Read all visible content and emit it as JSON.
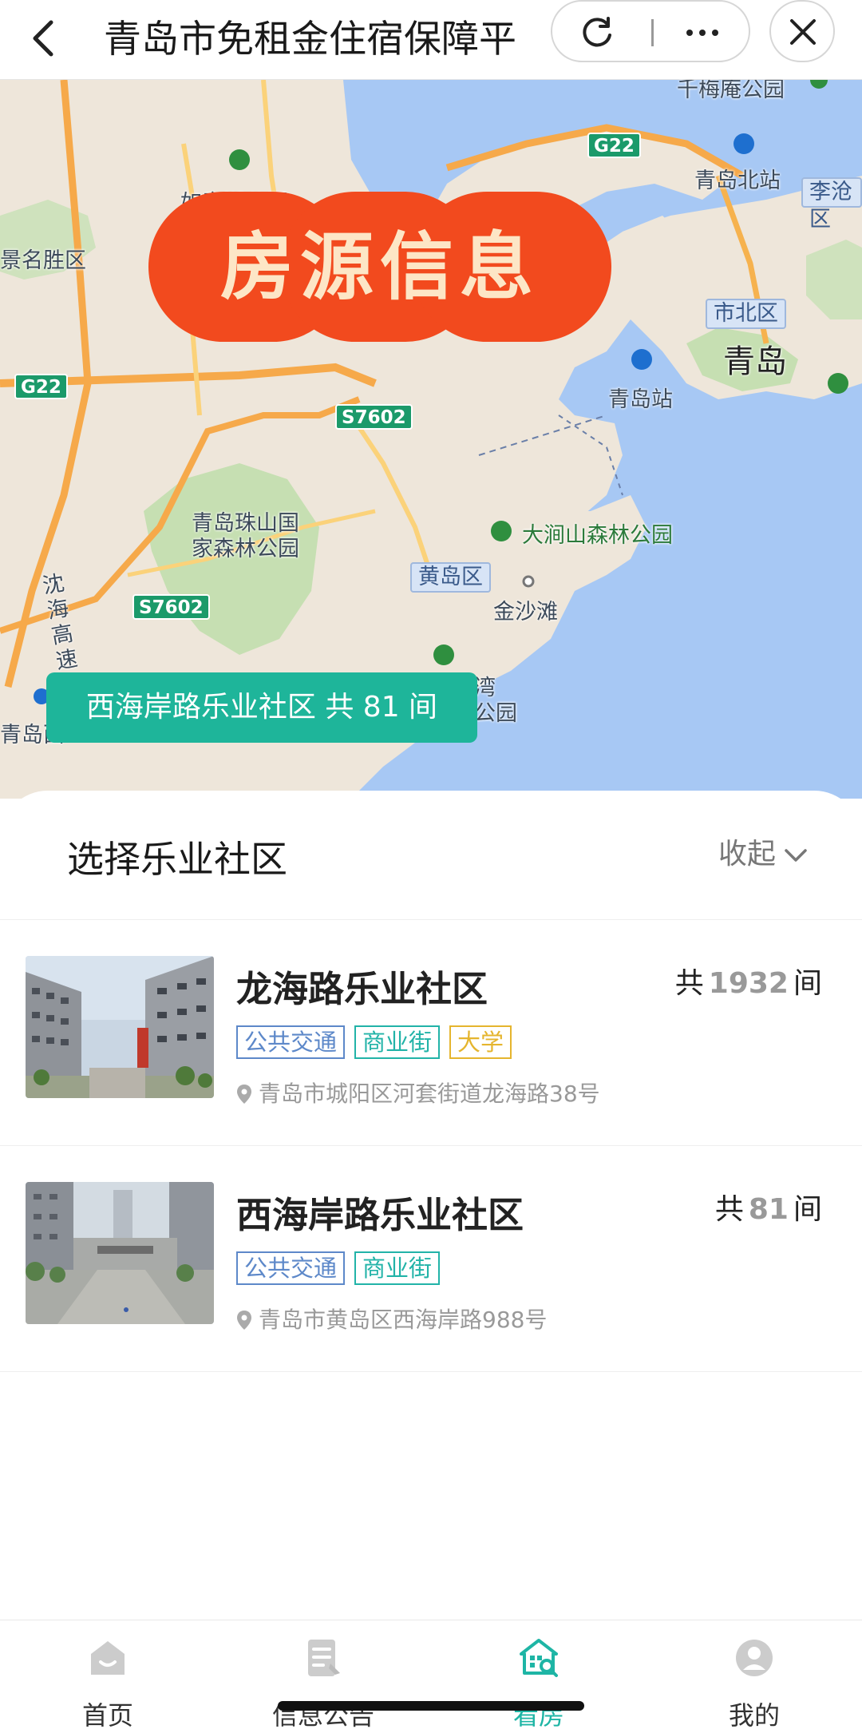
{
  "header": {
    "title": "青岛市免租金住宿保障平",
    "icons": {
      "back": "back-arrow-icon",
      "refresh": "refresh-icon",
      "more": "more-dots-icon",
      "close": "close-icon"
    }
  },
  "map": {
    "hero_text": "房源信息",
    "highlight": "西海岸路乐业社区 共 81 间",
    "labels": {
      "qingdao": "青岛",
      "qingdao_north_station": "青岛北站",
      "qingdao_station": "青岛站",
      "licang_partial": "李沧区",
      "shibei": "市北区",
      "huangdao": "黄岛区",
      "jinshatan": "金沙滩",
      "dazhushan": "大涧山森林公园",
      "zhushan": "青岛珠山国\n家森林公园",
      "scenic_partial": "景名胜区",
      "park_top_partial": "如意湖公园",
      "park_top_right_partial": "千梅庵公园",
      "bay_park_partial": "湾\n公园",
      "highway_partial": "沈\n海\n高\n速",
      "qingdao_west_partial": "青岛西"
    },
    "shields": {
      "g22_top": "G22",
      "g22_left": "G22",
      "s7602_mid": "S7602",
      "s7602_left": "S7602"
    }
  },
  "sheet": {
    "title": "选择乐业社区",
    "collapse_label": "收起",
    "items": [
      {
        "name": "龙海路乐业社区",
        "count_prefix": "共",
        "count": "1932",
        "count_suffix": "间",
        "tags": [
          "公共交通",
          "商业街",
          "大学"
        ],
        "address": "青岛市城阳区河套街道龙海路38号"
      },
      {
        "name": "西海岸路乐业社区",
        "count_prefix": "共",
        "count": "81",
        "count_suffix": "间",
        "tags": [
          "公共交通",
          "商业街"
        ],
        "address": "青岛市黄岛区西海岸路988号"
      }
    ]
  },
  "tabbar": {
    "items": [
      {
        "label": "首页",
        "icon": "home-icon"
      },
      {
        "label": "信息公告",
        "icon": "notice-icon"
      },
      {
        "label": "看房",
        "icon": "house-search-icon"
      },
      {
        "label": "我的",
        "icon": "user-icon"
      }
    ],
    "active_color": "#1eb5a5"
  },
  "colors": {
    "accent": "#1eb59a",
    "hero": "#f24a1e",
    "water": "#a7c8f4"
  }
}
